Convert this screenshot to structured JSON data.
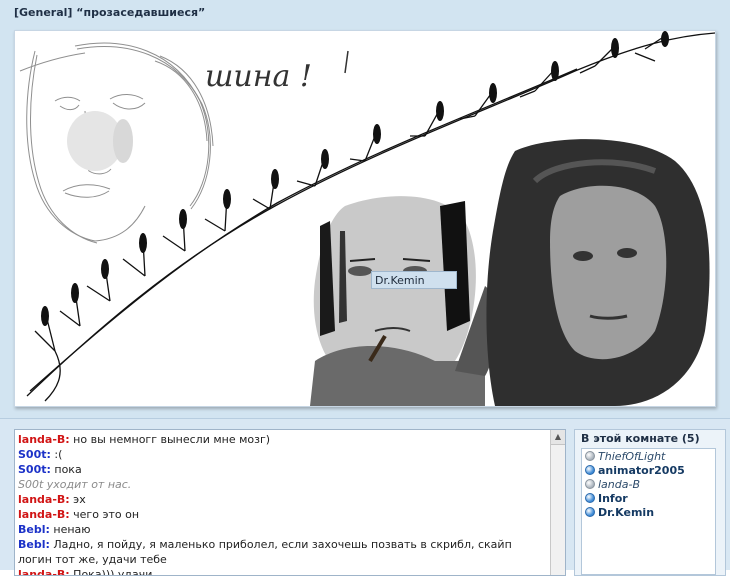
{
  "room": {
    "title": "[General] “прозаседавшиеся”"
  },
  "canvas": {
    "cursor_label": "Dr.Kemin",
    "drawn_text": "шина !"
  },
  "chat": {
    "messages": [
      {
        "nick": "landa-B:",
        "text": "но вы немногг вынесли мне мозг)",
        "color": "#d11515"
      },
      {
        "nick": "S00t:",
        "text": ":(",
        "color": "#1c32c8"
      },
      {
        "nick": "S00t:",
        "text": "пока",
        "color": "#1c32c8"
      },
      {
        "nick": "",
        "text": "S00t уходит от нас.",
        "color": "#8a8a8a",
        "system": true
      },
      {
        "nick": "landa-B:",
        "text": "эх",
        "color": "#d11515"
      },
      {
        "nick": "landa-B:",
        "text": "чего это он",
        "color": "#d11515"
      },
      {
        "nick": "Bebl:",
        "text": "ненаю",
        "color": "#1c32c8"
      },
      {
        "nick": "Bebl:",
        "text": "Ладно, я пойду, я маленько приболел, если захочешь позвать в скрибл, скайп логин тот же, удачи тебе",
        "color": "#1c32c8"
      },
      {
        "nick": "landa-B:",
        "text": "Пока))) удачи",
        "color": "#d11515"
      }
    ]
  },
  "room_users": {
    "header": "В этой комнате (5)",
    "users": [
      {
        "name": "ThiefOfLight",
        "status": "away"
      },
      {
        "name": "animator2005",
        "status": "online"
      },
      {
        "name": "landa-B",
        "status": "away"
      },
      {
        "name": "Infor",
        "status": "online"
      },
      {
        "name": "Dr.Kemin",
        "status": "online"
      }
    ]
  },
  "colors": {
    "panel_bg": "#d2e4f1",
    "nick_red": "#d11515",
    "nick_blue": "#1c32c8"
  }
}
